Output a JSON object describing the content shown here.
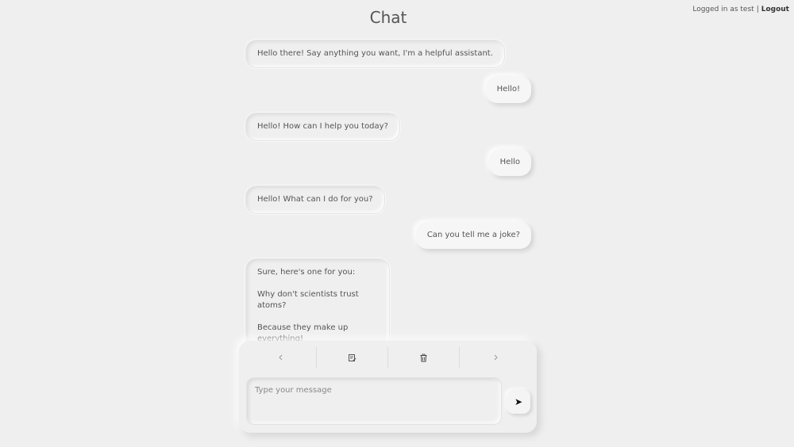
{
  "header": {
    "title": "Chat",
    "logged_in_text": "Logged in as test",
    "separator": "|",
    "logout_label": "Logout"
  },
  "messages": [
    {
      "role": "assistant",
      "lines": [
        "Hello there! Say anything you want, I'm a helpful assistant."
      ]
    },
    {
      "role": "user",
      "lines": [
        "Hello!"
      ]
    },
    {
      "role": "assistant",
      "lines": [
        "Hello! How can I help you today?"
      ]
    },
    {
      "role": "user",
      "lines": [
        "Hello"
      ]
    },
    {
      "role": "assistant",
      "lines": [
        "Hello! What can I do for you?"
      ]
    },
    {
      "role": "user",
      "lines": [
        "Can you tell me a joke?"
      ]
    },
    {
      "role": "assistant",
      "lines": [
        "Sure, here's one for you:",
        "Why don't scientists trust atoms?",
        "Because they make up everything!"
      ]
    }
  ],
  "toolbar": {
    "icons": [
      "chevron-left-icon",
      "edit-note-icon",
      "trash-icon",
      "chevron-right-icon"
    ]
  },
  "composer": {
    "placeholder": "Type your message",
    "value": "",
    "send_glyph": "➤"
  }
}
